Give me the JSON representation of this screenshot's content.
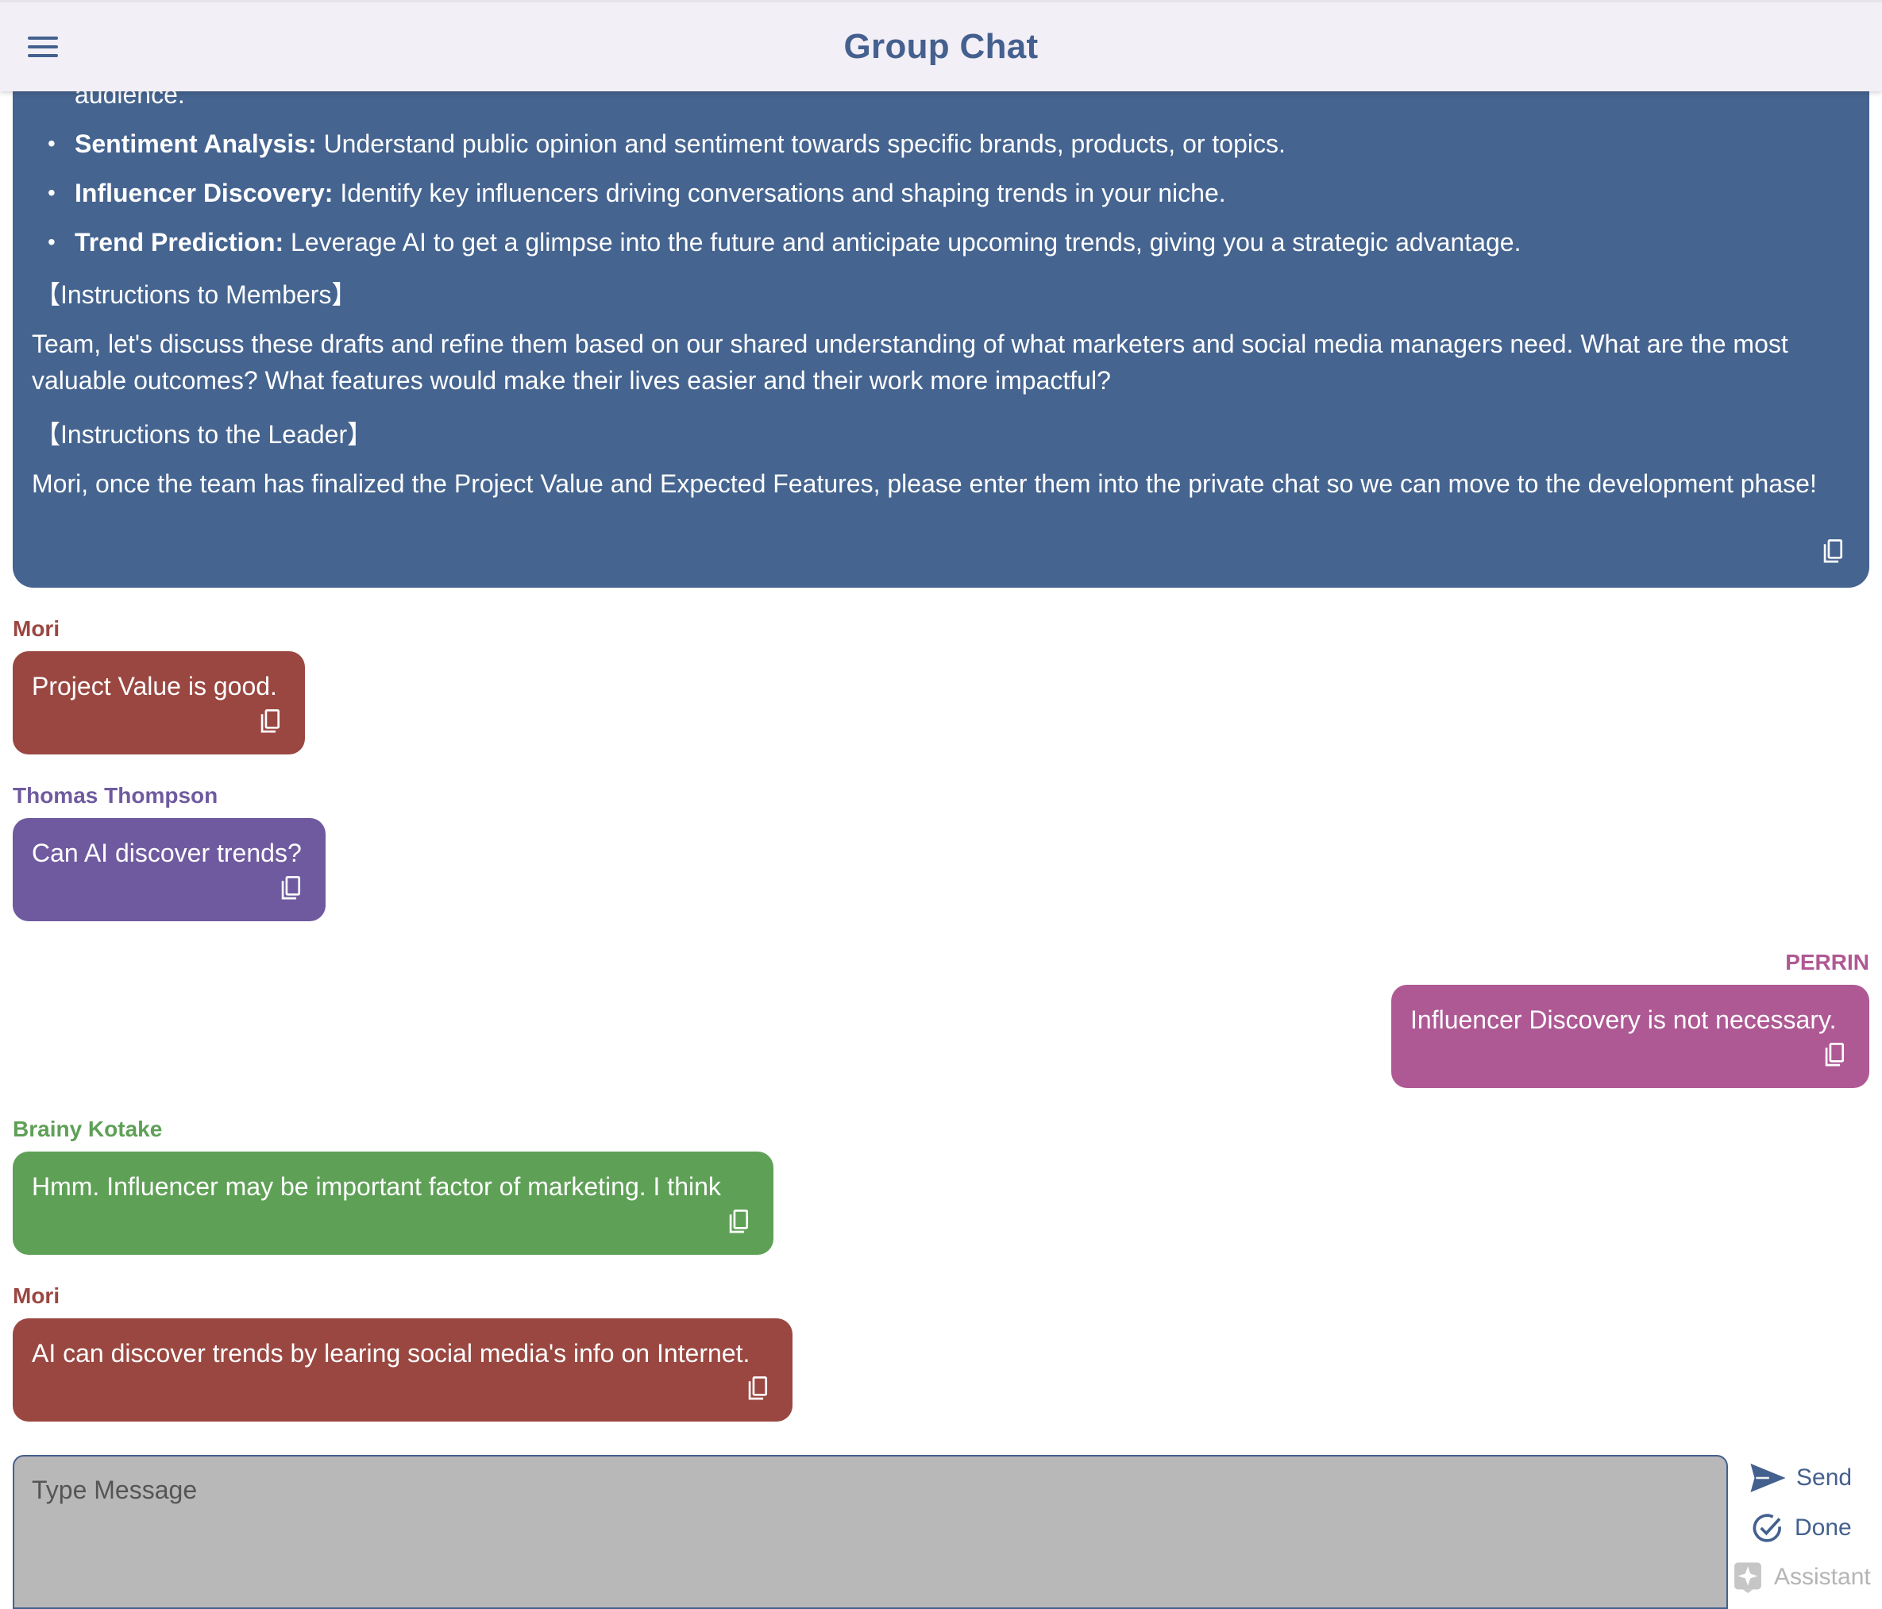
{
  "header": {
    "title": "Group Chat",
    "menu_icon": "menu-icon"
  },
  "leader_message": {
    "clipped_text": "audience.",
    "bullets": [
      {
        "bold": "Sentiment Analysis:",
        "text": " Understand public opinion and sentiment towards specific brands, products, or topics."
      },
      {
        "bold": "Influencer Discovery:",
        "text": " Identify key influencers driving conversations and shaping trends in your niche."
      },
      {
        "bold": "Trend Prediction:",
        "text": " Leverage AI to get a glimpse into the future and anticipate upcoming trends, giving you a strategic advantage."
      }
    ],
    "members_heading": "【Instructions to Members】",
    "members_text": "Team, let's discuss these drafts and refine them based on our shared understanding of what marketers and social media managers need. What are the most valuable outcomes? What features would make their lives easier and their work more impactful?",
    "leader_heading": "【Instructions to the Leader】",
    "leader_text": "Mori, once the team has finalized the Project Value and Expected Features, please enter them into the private chat so we can move to the development phase!",
    "color": "#456490"
  },
  "messages": [
    {
      "sender": "Mori",
      "text": "Project Value is good.",
      "color": "#9a4741",
      "align": "left"
    },
    {
      "sender": "Thomas Thompson",
      "text": "Can AI discover trends?",
      "color": "#6f5a9f",
      "align": "left"
    },
    {
      "sender": "PERRIN",
      "text": "Influencer Discovery is not necessary.",
      "color": "#ae5994",
      "align": "right"
    },
    {
      "sender": "Brainy Kotake",
      "text": "Hmm. Influencer may be important factor of marketing. I think",
      "color": "#5fa057",
      "align": "left"
    },
    {
      "sender": "Mori",
      "text": "AI can discover trends by learing social media's info on Internet.",
      "color": "#9a4741",
      "align": "left"
    }
  ],
  "composer": {
    "placeholder": "Type Message",
    "value": ""
  },
  "actions": {
    "send_label": "Send",
    "done_label": "Done",
    "assistant_label": "Assistant"
  },
  "colors": {
    "accent": "#44608e",
    "header_bg": "#f3eff7",
    "composer_bg": "#b8b8b8"
  }
}
